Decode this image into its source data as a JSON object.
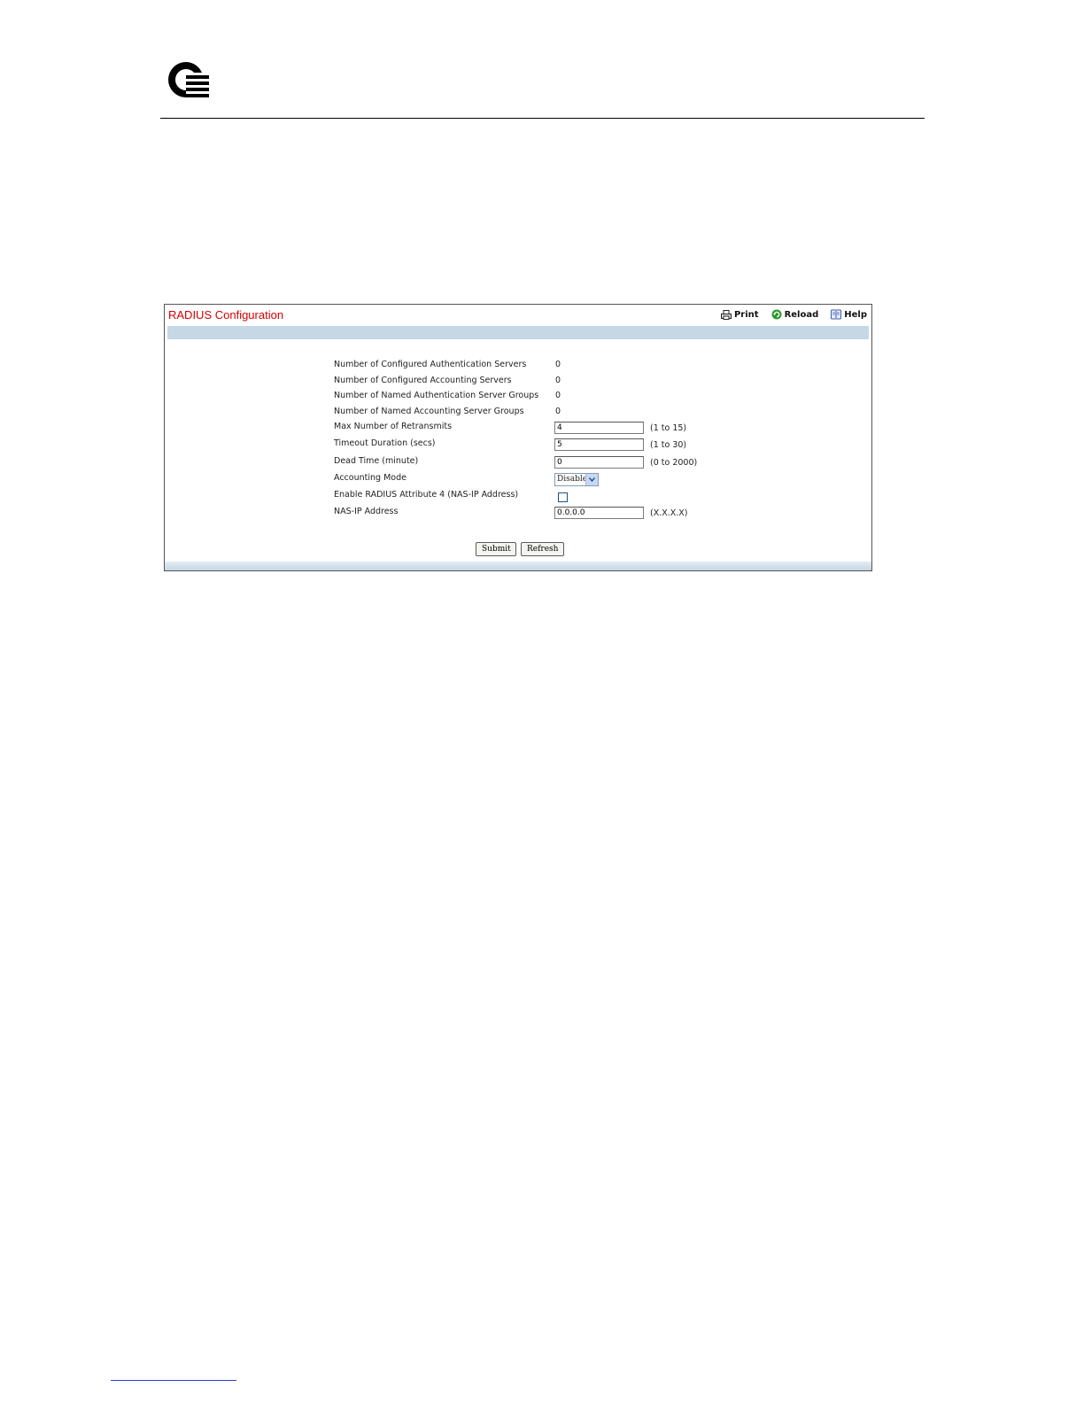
{
  "panel": {
    "title": "RADIUS Configuration",
    "toolbar": {
      "print_label": "Print",
      "reload_label": "Reload",
      "help_label": "Help"
    }
  },
  "stats": [
    {
      "label": "Number of Configured Authentication Servers",
      "value": "0"
    },
    {
      "label": "Number of Configured Accounting Servers",
      "value": "0"
    },
    {
      "label": "Number of Named Authentication Server Groups",
      "value": "0"
    },
    {
      "label": "Number of Named Accounting Server Groups",
      "value": "0"
    }
  ],
  "fields": {
    "max_retransmits": {
      "label": "Max Number of Retransmits",
      "value": "4",
      "range": "(1 to 15)"
    },
    "timeout_duration": {
      "label": "Timeout Duration (secs)",
      "value": "5",
      "range": "(1 to 30)"
    },
    "dead_time": {
      "label": "Dead Time (minute)",
      "value": "0",
      "range": "(0 to 2000)"
    },
    "accounting_mode": {
      "label": "Accounting Mode",
      "selected": "Disable"
    },
    "nas_ip_attr": {
      "label": "Enable RADIUS Attribute 4 (NAS-IP Address)",
      "checked": false
    },
    "nas_ip_address": {
      "label": "NAS-IP Address",
      "value": "0.0.0.0",
      "range": "(X.X.X.X)"
    }
  },
  "buttons": {
    "submit_label": "Submit",
    "refresh_label": "Refresh"
  },
  "colors": {
    "title": "#d40000",
    "bar": "#c6d7e5"
  },
  "icons": [
    "brand-logo",
    "print-icon",
    "reload-icon",
    "help-icon",
    "chevron-down-icon"
  ]
}
